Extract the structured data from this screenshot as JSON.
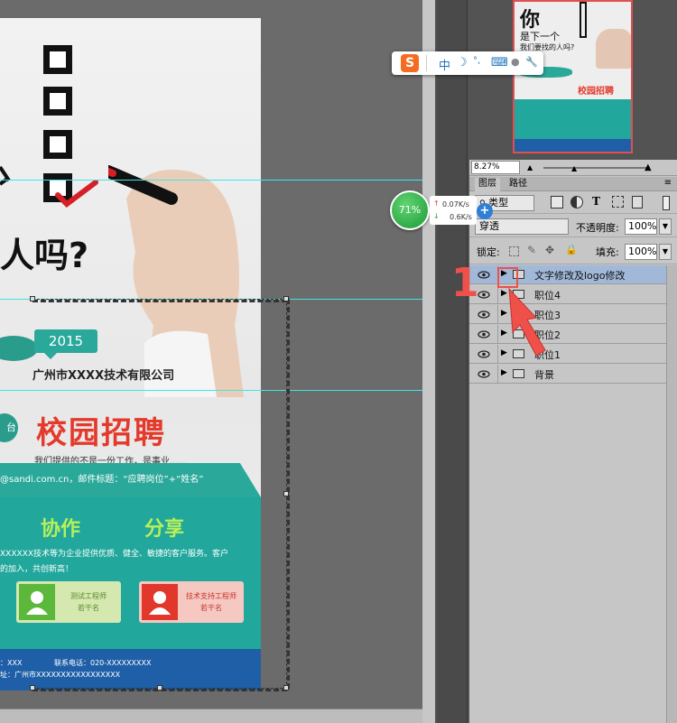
{
  "poster": {
    "question": "人吗?",
    "badge_year": "2015",
    "company": "广州市XXXX技术有限公司",
    "left_bubble": "台",
    "recruit_title": "校园招聘",
    "slogan": "我们提供的不是一份工作，是事业......",
    "email_line": "@sandi.com.cn，邮件标题：“应聘岗位”+“姓名”",
    "word_cooperate": "协作",
    "word_share": "分享",
    "desc_line1": "XXXXXX技术等为企业提供优质、健全、敏捷的客户服务。客户",
    "desc_line2": "的加入，共创新高！",
    "card1_line1": "测试工程师",
    "card1_line2": "若干名",
    "card2_line1": "技术支持工程师",
    "card2_line2": "若干名",
    "footer_line1_left": "：XXX",
    "footer_line1_right": "联系电话：020-XXXXXXXXX",
    "footer_line2": "址：广州市XXXXXXXXXXXXXXXXX"
  },
  "navigator": {
    "thumb_line1": "你",
    "thumb_line2": "是下一个",
    "thumb_line3": "我们要找的人吗?",
    "thumb_recruit": "校园招聘",
    "zoom": "8.27%"
  },
  "panel_tabs": {
    "layers": "图层",
    "paths": "路径"
  },
  "layers_panel": {
    "filter_kind": "类型",
    "blend_mode": "穿透",
    "opacity_label": "不透明度:",
    "opacity_value": "100%",
    "lock_label": "锁定:",
    "fill_label": "填充:",
    "fill_value": "100%",
    "layers": [
      {
        "name": "文字修改及logo修改",
        "selected": true
      },
      {
        "name": "职位4",
        "selected": false
      },
      {
        "name": "职位3",
        "selected": false
      },
      {
        "name": "职位2",
        "selected": false
      },
      {
        "name": "职位1",
        "selected": false
      },
      {
        "name": "背景",
        "selected": false
      }
    ]
  },
  "ime_toolbar": {
    "logo": "S",
    "mode": "中",
    "moon": "☽",
    "punct": "°,",
    "keyboard": "⌨",
    "user": "●",
    "wrench": "🔧"
  },
  "speed_widget": {
    "percent": "71%",
    "upload": "0.07K/s",
    "download": "0.6K/s",
    "plus": "+"
  },
  "annotation": {
    "step_number": "1"
  },
  "colors": {
    "teal": "#21a79c",
    "recruit_red": "#e43a2b",
    "annotation_red": "#f0504a",
    "footer_blue": "#1f5fa8",
    "guide_cyan": "#3ee6e6",
    "selected_layer": "#a2b8d8"
  }
}
